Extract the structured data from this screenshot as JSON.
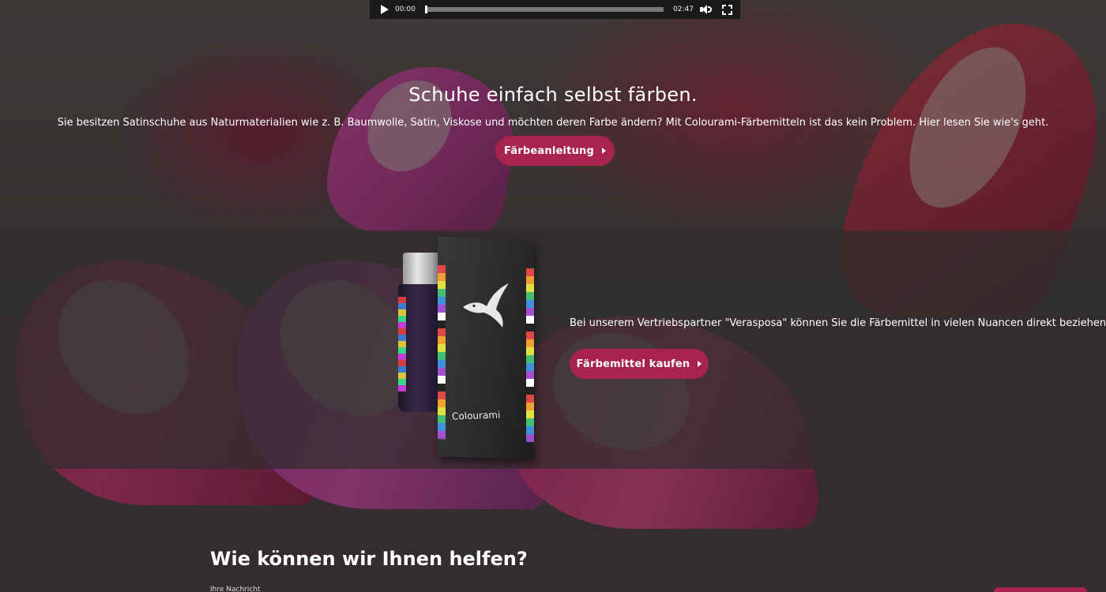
{
  "player": {
    "current_time": "00:00",
    "duration": "02:47",
    "progress": 0
  },
  "hero": {
    "title": "Schuhe einfach selbst färben.",
    "text": "Sie besitzen Satinschuhe aus Naturmaterialien wie z. B. Baumwolle, Satin, Viskose und möchten deren Farbe ändern? Mit Colourami-Färbemitteln ist das kein Problem. Hier lesen Sie wie's geht.",
    "button_label": "Färbeanleitung"
  },
  "partner": {
    "text": "Bei unserem Vertriebspartner \"Verasposa\" können Sie die Färbemittel in vielen Nuancen direkt beziehen.",
    "button_label": "Färbemittel kaufen",
    "product_brand": "Colourami"
  },
  "help": {
    "title": "Wie können wir Ihnen helfen?",
    "label": "Ihre Nachricht"
  },
  "colors": {
    "accent": "#a8234f",
    "player_bg": "#1a1a1a",
    "band_overlay": "#302e2e"
  }
}
